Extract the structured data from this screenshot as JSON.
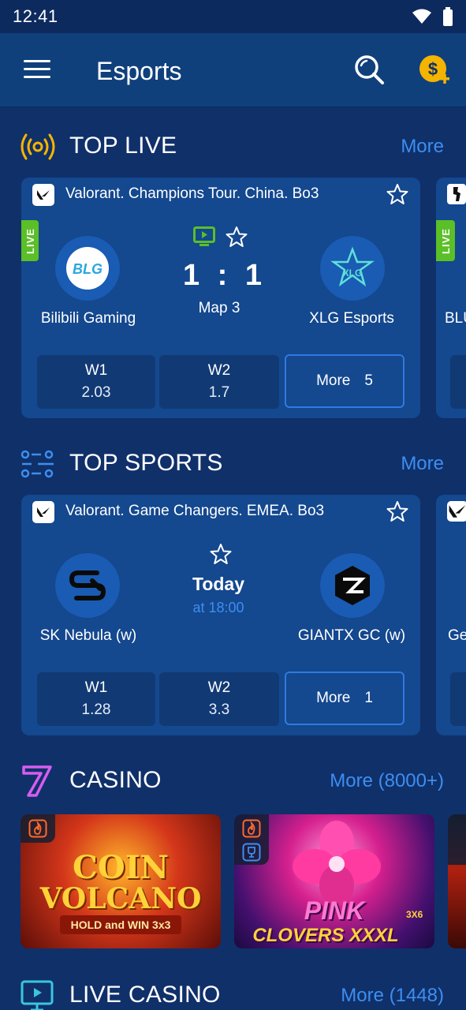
{
  "status": {
    "time": "12:41"
  },
  "header": {
    "title": "Esports"
  },
  "top_live": {
    "title": "TOP LIVE",
    "more": "More",
    "card": {
      "league": "Valorant. Champions Tour. China. Bo3",
      "live_label": "LIVE",
      "team1": "Bilibili Gaming",
      "team1_logo_text": "BLG",
      "team2": "XLG Esports",
      "team2_logo_text": "XLG",
      "score1": "1",
      "score_sep": ":",
      "score2": "1",
      "period": "Map 3",
      "odds": [
        {
          "label": "W1",
          "value": "2.03"
        },
        {
          "label": "W2",
          "value": "1.7"
        }
      ],
      "more_label": "More",
      "more_count": "5"
    },
    "peek": {
      "live_label": "LIVE",
      "team": "BLU"
    }
  },
  "top_sports": {
    "title": "TOP SPORTS",
    "more": "More",
    "card": {
      "league": "Valorant. Game Changers. EMEA. Bo3",
      "team1": "SK Nebula (w)",
      "team2": "GIANTX GC (w)",
      "date": "Today",
      "time": "at 18:00",
      "odds": [
        {
          "label": "W1",
          "value": "1.28"
        },
        {
          "label": "W2",
          "value": "3.3"
        }
      ],
      "more_label": "More",
      "more_count": "1"
    },
    "peek": {
      "team": "Ge"
    }
  },
  "casino": {
    "title": "CASINO",
    "more": "More (8000+)",
    "games": [
      {
        "line1": "COIN",
        "line2": "VOLCANO",
        "line3": "HOLD and WIN 3x3"
      },
      {
        "line1": "PINK",
        "line2": "CLOVERS XXXL",
        "line3": "3X6"
      }
    ]
  },
  "live_casino": {
    "title": "LIVE CASINO",
    "more": "More (1448)"
  },
  "colors": {
    "accent": "#3d8ef0",
    "live": "#5bbf27",
    "gold": "#f5b400",
    "bg": "#10306a",
    "card": "#14488f"
  }
}
